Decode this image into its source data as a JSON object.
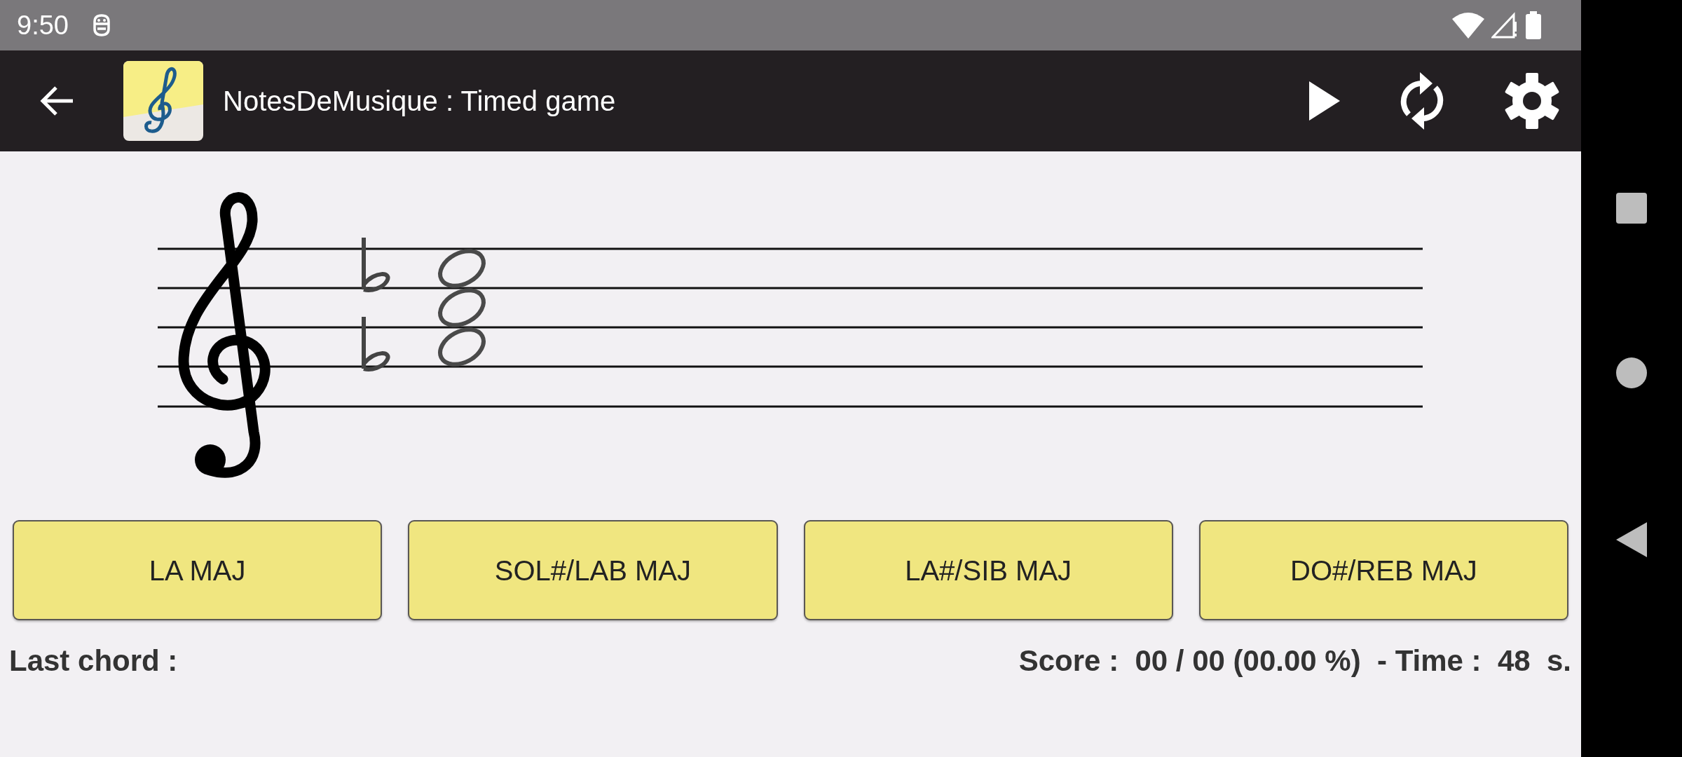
{
  "status_bar": {
    "time": "9:50"
  },
  "app_bar": {
    "title": "NotesDeMusique : Timed game"
  },
  "answers": [
    {
      "label": "LA MAJ"
    },
    {
      "label": "SOL#/LAB MAJ"
    },
    {
      "label": "LA#/SIB MAJ"
    },
    {
      "label": "DO#/REB MAJ"
    }
  ],
  "footer": {
    "last_chord": "Last chord :",
    "score": "Score :  00 / 00 (00.00 %)  - Time :  48  s."
  }
}
